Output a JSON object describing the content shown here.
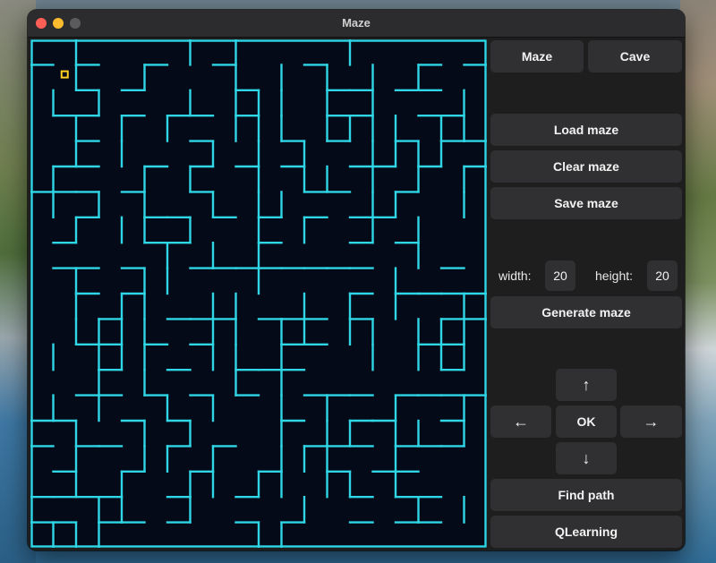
{
  "window": {
    "title": "Maze"
  },
  "toolbar": {
    "maze_tab": "Maze",
    "cave_tab": "Cave"
  },
  "file": {
    "load": "Load maze",
    "clear": "Clear maze",
    "save": "Save maze"
  },
  "size": {
    "width_label": "width:",
    "width_value": "20",
    "height_label": "height:",
    "height_value": "20",
    "generate": "Generate maze"
  },
  "nav": {
    "up": "↑",
    "down": "↓",
    "left": "←",
    "right": "→",
    "ok": "OK"
  },
  "actions": {
    "find_path": "Find path",
    "qlearning": "QLearning"
  },
  "maze": {
    "rows": 20,
    "cols": 20,
    "wall_color": "#2fd6e6",
    "background": "#050a18",
    "marker_color": "#ffd21f",
    "marker_cell": [
      1,
      1
    ],
    "grid": [
      "01000010100001000000",
      "01001000101010101000",
      "10100010111010100011",
      "01010100111011110111",
      "01010001010100111101",
      "10001010010110101010",
      "10101001011000110011",
      "01011010010100101001",
      "00000101010000001000",
      "01001100010000010000",
      "01011001100101010010",
      "01111001101101101110",
      "10111001101000101111",
      "00101000101000000001",
      "10100101001010010011",
      "01001010001011011010",
      "01001101001110010001",
      "01010011011011010000",
      "00110010000100001011",
      "11100000011000000000"
    ],
    "hwalls": [
      "10100100100010000101",
      "00101000010001101100",
      "01101011010001100110",
      "00100001000101001011",
      "01100101010100110101",
      "11101001000011001000",
      "00100110101010110000",
      "01000110001000101000",
      "01101001111111100010",
      "00101000000000101111",
      "00010011101110100011",
      "00110101000110000110",
      "00010010011100000010",
      "00110101010011101111",
      "11001010000100110010",
      "10110010100011101110",
      "01001001001001011000",
      "11110010010000101100",
      "11011010010100101100"
    ]
  }
}
